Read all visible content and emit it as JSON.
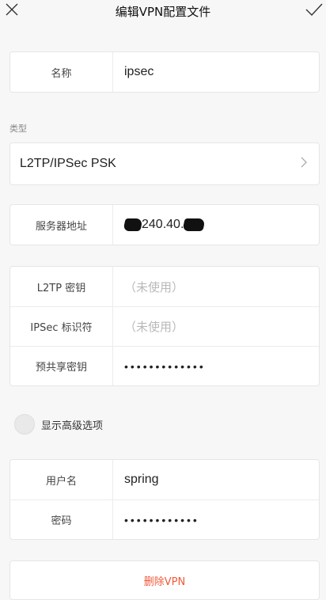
{
  "header": {
    "title": "编辑VPN配置文件",
    "close_icon": "close-icon",
    "confirm_icon": "checkmark-icon"
  },
  "name_field": {
    "label": "名称",
    "value": "ipsec"
  },
  "type_section": {
    "label": "类型",
    "value": "L2TP/IPSec PSK",
    "icon": "chevron-right-icon"
  },
  "server_field": {
    "label": "服务器地址",
    "value": "240.40."
  },
  "auth_group": {
    "l2tp_key": {
      "label": "L2TP 密钥",
      "placeholder": "（未使用）"
    },
    "ipsec_id": {
      "label": "IPSec 标识符",
      "placeholder": "（未使用）"
    },
    "psk": {
      "label": "预共享密钥",
      "value": "•••••••••••••"
    }
  },
  "advanced_toggle": {
    "label": "显示高级选项"
  },
  "account_group": {
    "username": {
      "label": "用户名",
      "value": "spring"
    },
    "password": {
      "label": "密码",
      "value": "••••••••••••"
    }
  },
  "delete_button": {
    "label": "删除VPN"
  },
  "colors": {
    "accent_delete": "#f0593a",
    "background": "#f7f7f7"
  }
}
